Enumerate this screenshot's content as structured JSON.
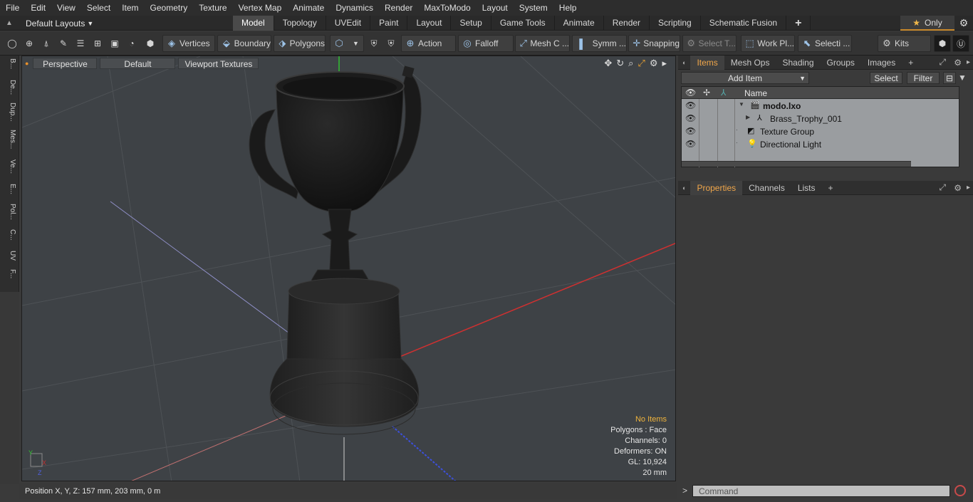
{
  "menu": [
    "File",
    "Edit",
    "View",
    "Select",
    "Item",
    "Geometry",
    "Texture",
    "Vertex Map",
    "Animate",
    "Dynamics",
    "Render",
    "MaxToModo",
    "Layout",
    "System",
    "Help"
  ],
  "layout_selector": "Default Layouts",
  "mode_tabs": [
    "Model",
    "Topology",
    "UVEdit",
    "Paint",
    "Layout",
    "Setup",
    "Game Tools",
    "Animate",
    "Render",
    "Scripting",
    "Schematic Fusion",
    "+"
  ],
  "active_mode_tab": "Model",
  "only_label": "Only",
  "toolbar": {
    "vertices": "Vertices",
    "boundary": "Boundary",
    "polygons": "Polygons",
    "action": "Action",
    "falloff": "Falloff",
    "mesh": "Mesh C ...",
    "symm": "Symm ...",
    "snapping": "Snapping",
    "select_t": "Select T...",
    "work_pl": "Work Pl...",
    "selecti": "Selecti ...",
    "kits": "Kits"
  },
  "left_tabs": [
    "B...",
    "De...",
    "Dup...",
    "Mes...",
    "Ve...",
    "E...",
    "Pol...",
    "C...",
    "UV",
    "F..."
  ],
  "viewport": {
    "perspective": "Perspective",
    "default": "Default",
    "textures": "Viewport Textures",
    "info": {
      "no_items": "No Items",
      "polygons": "Polygons : Face",
      "channels": "Channels: 0",
      "deformers": "Deformers: ON",
      "gl": "GL: 10,924",
      "scale": "20 mm"
    }
  },
  "status": "Position X, Y, Z:   157 mm, 203 mm, 0 m",
  "items_panel": {
    "tabs": [
      "Items",
      "Mesh Ops",
      "Shading",
      "Groups",
      "Images",
      "+"
    ],
    "add_item": "Add Item",
    "select": "Select",
    "filter": "Filter",
    "name_header": "Name",
    "rows": [
      {
        "label": "modo.lxo"
      },
      {
        "label": "Brass_Trophy_001"
      },
      {
        "label": "Texture Group"
      },
      {
        "label": "Directional Light"
      }
    ]
  },
  "props_panel": {
    "tabs": [
      "Properties",
      "Channels",
      "Lists",
      "+"
    ]
  },
  "command_placeholder": "Command",
  "colors": {
    "accent": "#f0a64a",
    "axis_x": "#c83232",
    "axis_y": "#3cc83c",
    "axis_z": "#3c50dc"
  }
}
